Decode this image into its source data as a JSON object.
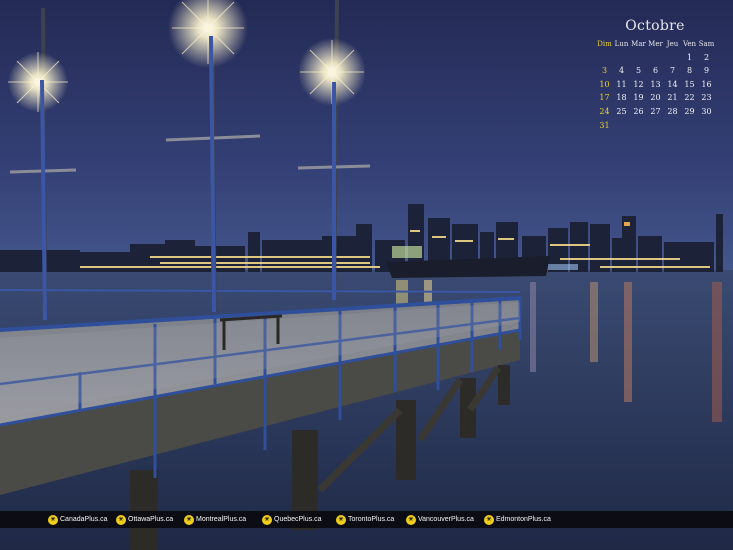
{
  "calendar": {
    "month": "Octobre",
    "weekdays": [
      "Dim",
      "Lun",
      "Mar",
      "Mer",
      "Jeu",
      "Ven",
      "Sam"
    ],
    "first_weekday_index": 5,
    "days_in_month": 31,
    "sunday_color": "#e8d22a"
  },
  "footer": {
    "links": [
      {
        "label": "CanadaPlus.ca",
        "icon": "sun-logo-icon"
      },
      {
        "label": "OttawaPlus.ca",
        "icon": "sun-logo-icon"
      },
      {
        "label": "MontrealPlus.ca",
        "icon": "sun-logo-icon"
      },
      {
        "label": "QuebecPlus.ca",
        "icon": "sun-logo-icon"
      },
      {
        "label": "TorontoPlus.ca",
        "icon": "sun-logo-icon"
      },
      {
        "label": "VancouverPlus.ca",
        "icon": "sun-logo-icon"
      },
      {
        "label": "EdmontonPlus.ca",
        "icon": "sun-logo-icon"
      }
    ],
    "accent": "#f0cf19"
  },
  "colors": {
    "sky_top": "#27305c",
    "sky_horizon": "#3e4f86",
    "water": "#2b3a5e",
    "railing": "#2f4f9a"
  }
}
